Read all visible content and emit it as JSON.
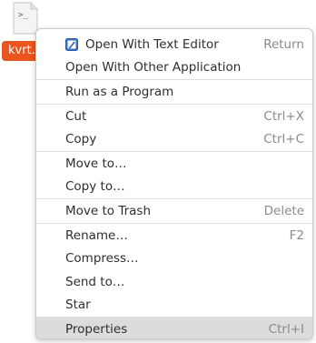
{
  "desktop": {
    "file": {
      "label": "kvrt...",
      "icon": "terminal-script-icon",
      "icon_glyph": ">_"
    }
  },
  "context_menu": {
    "sections": [
      {
        "items": [
          {
            "label": "Open With Text Editor",
            "accel": "Return",
            "icon": "text-editor-icon"
          },
          {
            "label": "Open With Other Application",
            "accel": ""
          }
        ]
      },
      {
        "items": [
          {
            "label": "Run as a Program",
            "accel": ""
          }
        ]
      },
      {
        "items": [
          {
            "label": "Cut",
            "accel": "Ctrl+X"
          },
          {
            "label": "Copy",
            "accel": "Ctrl+C"
          }
        ]
      },
      {
        "items": [
          {
            "label": "Move to…",
            "accel": ""
          },
          {
            "label": "Copy to…",
            "accel": ""
          }
        ]
      },
      {
        "items": [
          {
            "label": "Move to Trash",
            "accel": "Delete"
          }
        ]
      },
      {
        "items": [
          {
            "label": "Rename…",
            "accel": "F2"
          },
          {
            "label": "Compress…",
            "accel": ""
          },
          {
            "label": "Send to…",
            "accel": ""
          },
          {
            "label": "Star",
            "accel": ""
          }
        ]
      },
      {
        "items": [
          {
            "label": "Properties",
            "accel": "Ctrl+I"
          }
        ]
      }
    ],
    "hovered_item": "Properties"
  },
  "colors": {
    "accent": "#e95420",
    "menu_bg": "#ffffff",
    "hover_bg": "#dcdcdc",
    "text": "#2e2e2e",
    "accel_text": "#8a8a8a",
    "separator": "#dddddd"
  }
}
